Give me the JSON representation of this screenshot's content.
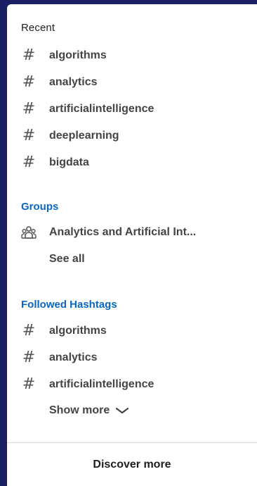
{
  "recent": {
    "title": "Recent",
    "items": [
      {
        "label": "algorithms"
      },
      {
        "label": "analytics"
      },
      {
        "label": "artificialintelligence"
      },
      {
        "label": "deeplearning"
      },
      {
        "label": "bigdata"
      }
    ]
  },
  "groups": {
    "title": "Groups",
    "items": [
      {
        "label": "Analytics and Artificial Int..."
      }
    ],
    "see_all": "See all"
  },
  "followed": {
    "title": "Followed Hashtags",
    "items": [
      {
        "label": "algorithms"
      },
      {
        "label": "analytics"
      },
      {
        "label": "artificialintelligence"
      }
    ],
    "show_more": "Show more"
  },
  "footer": {
    "discover": "Discover more"
  },
  "icons": {
    "hash": "#",
    "group": "group-icon",
    "chevron": "chevron-down-icon"
  },
  "colors": {
    "frame": "#1b1f63",
    "accent": "#0a66c2",
    "text_dark": "#1f1f1f",
    "text_label": "#444444"
  }
}
